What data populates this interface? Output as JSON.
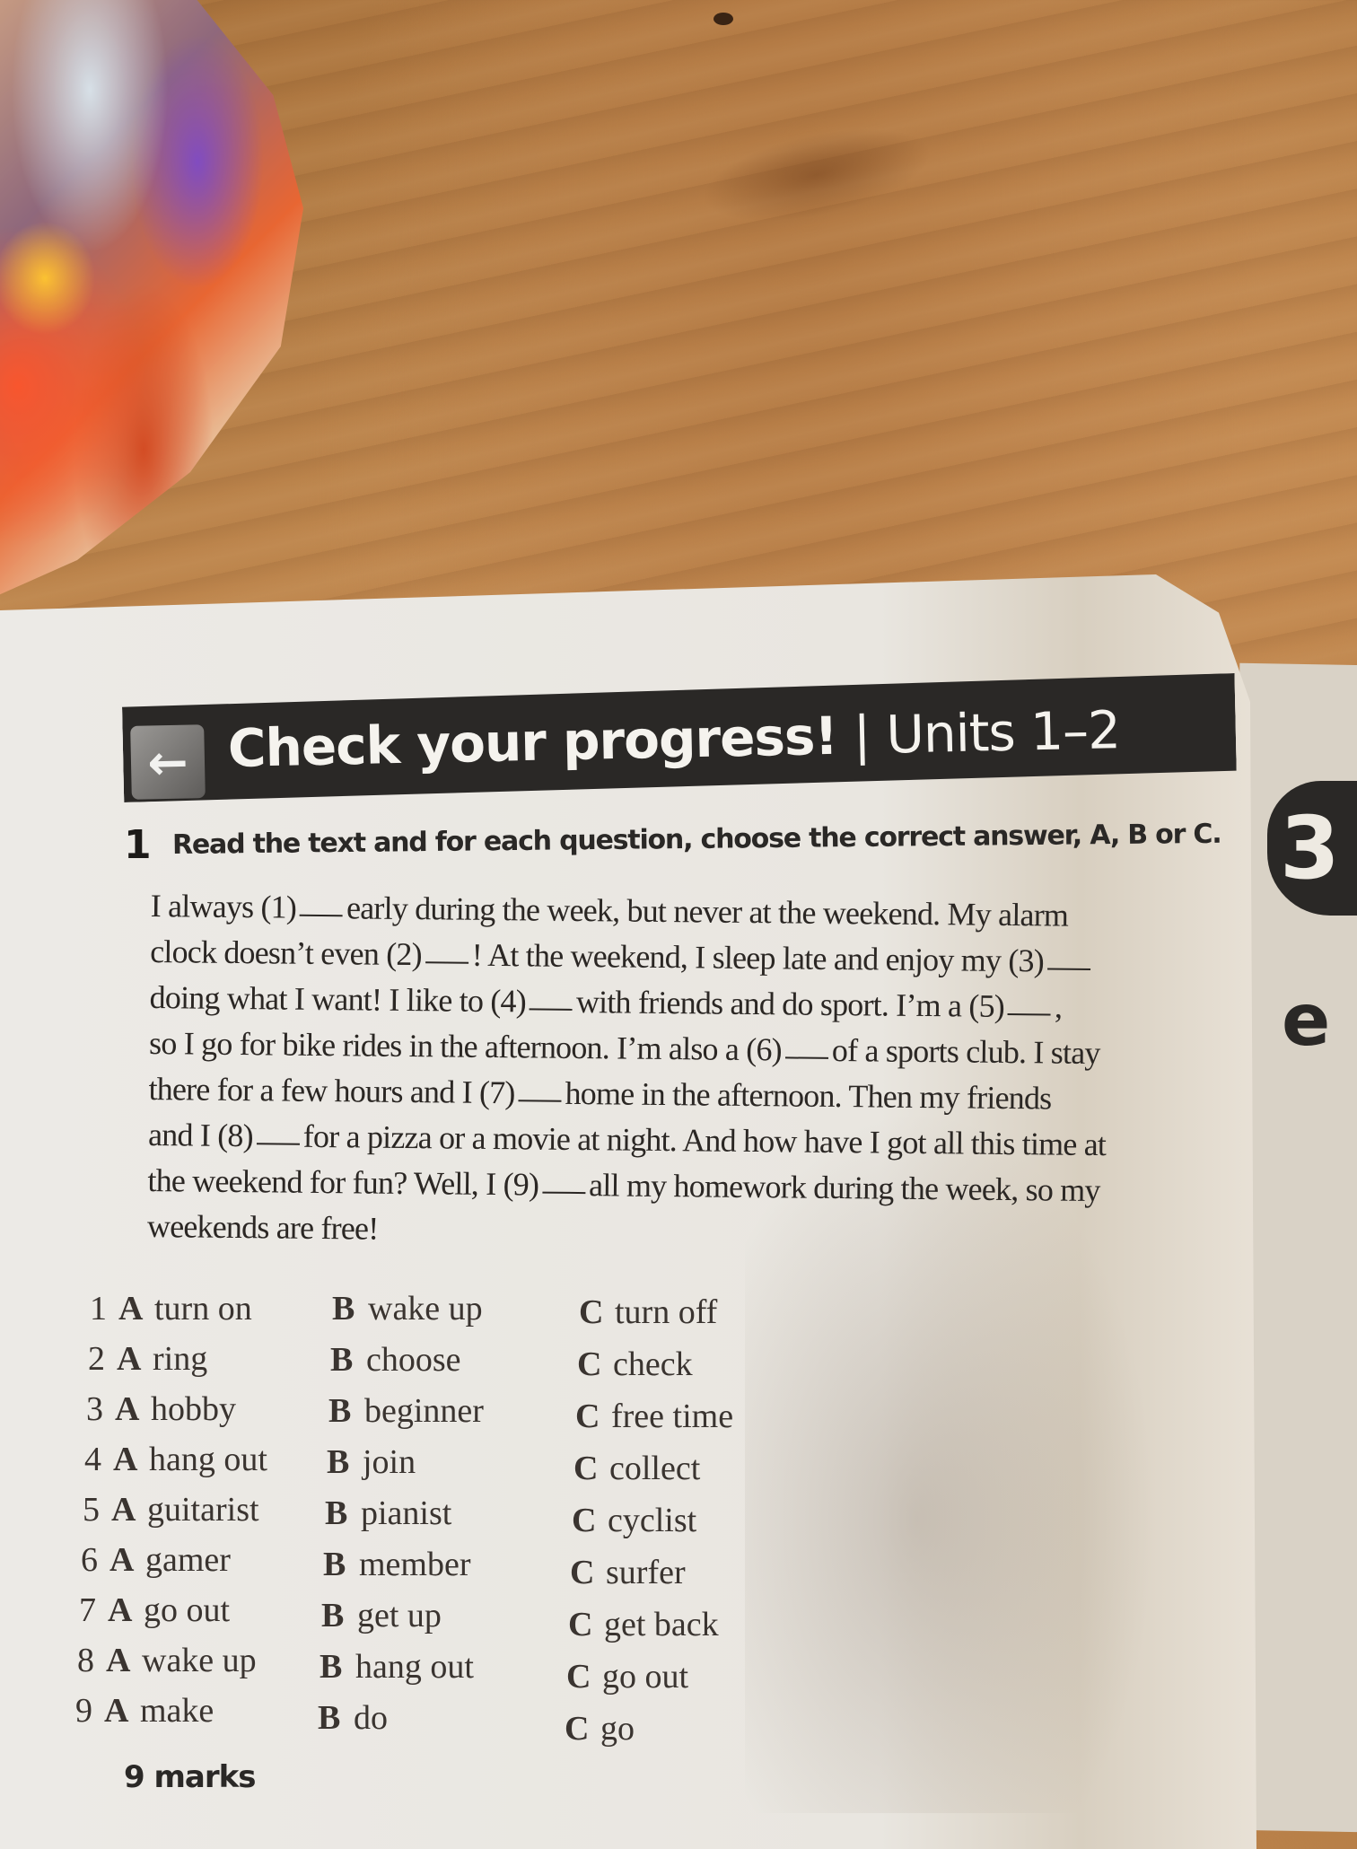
{
  "header": {
    "arrow_icon": "←",
    "title_bold": "Check your progress!",
    "separator": "|",
    "title_units": "Units 1–2"
  },
  "side_tab": {
    "unit_number": "3",
    "partial_letter": "e"
  },
  "exercise": {
    "number": "1",
    "instruction": "Read the text and for each question, choose the correct answer, A, B or C.",
    "passage_lines": [
      [
        "I always (1)",
        "early during the week, but never at the weekend. My alarm"
      ],
      [
        "clock doesn’t even (2)",
        "! At the weekend, I sleep late and enjoy my (3)",
        ""
      ],
      [
        "doing what I want! I like to (4)",
        "with friends and do sport. I’m a (5)",
        ","
      ],
      [
        "so I go for bike rides in the afternoon. I’m also a (6)",
        "of a sports club. I stay"
      ],
      [
        "there for a few hours and I (7)",
        "home in the afternoon. Then my friends"
      ],
      [
        "and I (8)",
        "for a pizza or a movie at night. And how have I got all this time at"
      ],
      [
        "the weekend for fun? Well, I (9)",
        "all my homework during the week, so my"
      ],
      [
        "weekends are free!"
      ]
    ],
    "options": [
      {
        "num": "1",
        "A": "turn on",
        "B": "wake up",
        "C": "turn off"
      },
      {
        "num": "2",
        "A": "ring",
        "B": "choose",
        "C": "check"
      },
      {
        "num": "3",
        "A": "hobby",
        "B": "beginner",
        "C": "free time"
      },
      {
        "num": "4",
        "A": "hang out",
        "B": "join",
        "C": "collect"
      },
      {
        "num": "5",
        "A": "guitarist",
        "B": "pianist",
        "C": "cyclist"
      },
      {
        "num": "6",
        "A": "gamer",
        "B": "member",
        "C": "surfer"
      },
      {
        "num": "7",
        "A": "go out",
        "B": "get up",
        "C": "get back"
      },
      {
        "num": "8",
        "A": "wake up",
        "B": "hang out",
        "C": "go out"
      },
      {
        "num": "9",
        "A": "make",
        "B": "do",
        "C": "go"
      }
    ],
    "option_letters": {
      "A": "A",
      "B": "B",
      "C": "C"
    },
    "marks": "9 marks"
  }
}
